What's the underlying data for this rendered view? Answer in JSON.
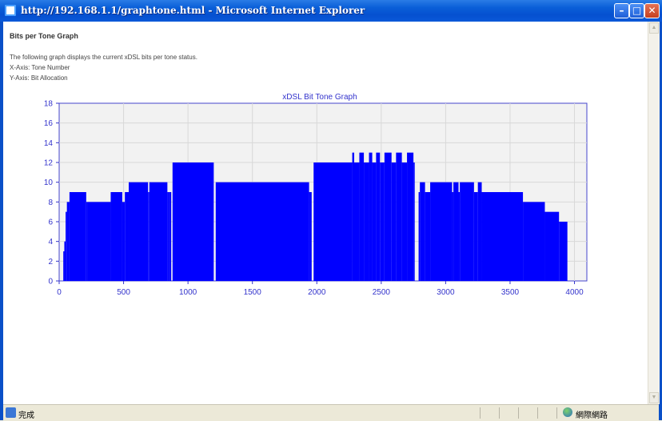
{
  "window": {
    "title": "http://192.168.1.1/graphtone.html - Microsoft Internet Explorer",
    "min_glyph": "–",
    "max_glyph": "□",
    "close_glyph": "✕"
  },
  "page": {
    "title": "Bits per Tone Graph",
    "description": "The following graph displays the current xDSL bits per tone status.",
    "x_axis_note": "X-Axis: Tone Number",
    "y_axis_note": "Y-Axis: Bit Allocation"
  },
  "chart_data": {
    "type": "bar",
    "title": "xDSL Bit Tone Graph",
    "xlabel": "",
    "ylabel": "",
    "xlim": [
      0,
      4096
    ],
    "ylim": [
      0,
      18
    ],
    "xticks": [
      0,
      500,
      1000,
      1500,
      2000,
      2500,
      3000,
      3500,
      4000
    ],
    "yticks": [
      0,
      2,
      4,
      6,
      8,
      10,
      12,
      14,
      16,
      18
    ],
    "grid": true,
    "bar_color": "#0000ff",
    "segments": [
      [
        32,
        40,
        3
      ],
      [
        40,
        50,
        4
      ],
      [
        50,
        60,
        7
      ],
      [
        60,
        80,
        8
      ],
      [
        80,
        210,
        9
      ],
      [
        210,
        220,
        8
      ],
      [
        220,
        400,
        8
      ],
      [
        400,
        490,
        9
      ],
      [
        490,
        510,
        8
      ],
      [
        510,
        540,
        9
      ],
      [
        540,
        690,
        10
      ],
      [
        690,
        700,
        9
      ],
      [
        700,
        840,
        10
      ],
      [
        840,
        855,
        9
      ],
      [
        855,
        870,
        9
      ],
      [
        880,
        1200,
        12
      ],
      [
        1215,
        1940,
        10
      ],
      [
        1940,
        1960,
        9
      ],
      [
        1975,
        2275,
        12
      ],
      [
        2275,
        2290,
        13
      ],
      [
        2290,
        2330,
        12
      ],
      [
        2330,
        2365,
        13
      ],
      [
        2365,
        2405,
        12
      ],
      [
        2405,
        2430,
        13
      ],
      [
        2430,
        2460,
        12
      ],
      [
        2460,
        2490,
        13
      ],
      [
        2490,
        2525,
        12
      ],
      [
        2525,
        2580,
        13
      ],
      [
        2580,
        2615,
        12
      ],
      [
        2615,
        2660,
        13
      ],
      [
        2660,
        2700,
        12
      ],
      [
        2700,
        2750,
        13
      ],
      [
        2750,
        2760,
        12
      ],
      [
        2790,
        2800,
        9
      ],
      [
        2800,
        2840,
        10
      ],
      [
        2840,
        2880,
        9
      ],
      [
        2880,
        3050,
        10
      ],
      [
        3050,
        3060,
        9
      ],
      [
        3060,
        3100,
        10
      ],
      [
        3100,
        3110,
        9
      ],
      [
        3110,
        3220,
        10
      ],
      [
        3220,
        3250,
        9
      ],
      [
        3250,
        3280,
        10
      ],
      [
        3280,
        3600,
        9
      ],
      [
        3600,
        3770,
        8
      ],
      [
        3770,
        3880,
        7
      ],
      [
        3880,
        3945,
        6
      ]
    ]
  },
  "statusbar": {
    "status_text": "完成",
    "zone_text": "網際網路"
  }
}
